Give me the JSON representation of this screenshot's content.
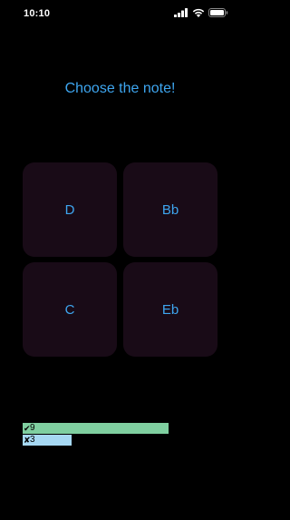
{
  "status_bar": {
    "time": "10:10",
    "icons": [
      "signal-icon",
      "wifi-icon",
      "battery-icon"
    ]
  },
  "prompt": {
    "title": "Choose the note!",
    "color": "#3ea6f0"
  },
  "notes": [
    {
      "label": "D"
    },
    {
      "label": "Bb"
    },
    {
      "label": "C"
    },
    {
      "label": "Eb"
    }
  ],
  "score": {
    "correct": {
      "mark": "✔",
      "count": "9",
      "color": "#7fcfa0",
      "fraction": 0.45
    },
    "wrong": {
      "mark": "✘",
      "count": "3",
      "color": "#a6d8f2",
      "fraction": 0.15
    }
  },
  "colors": {
    "background": "#000000",
    "button": "#190b17",
    "accent": "#3ea6f0"
  }
}
